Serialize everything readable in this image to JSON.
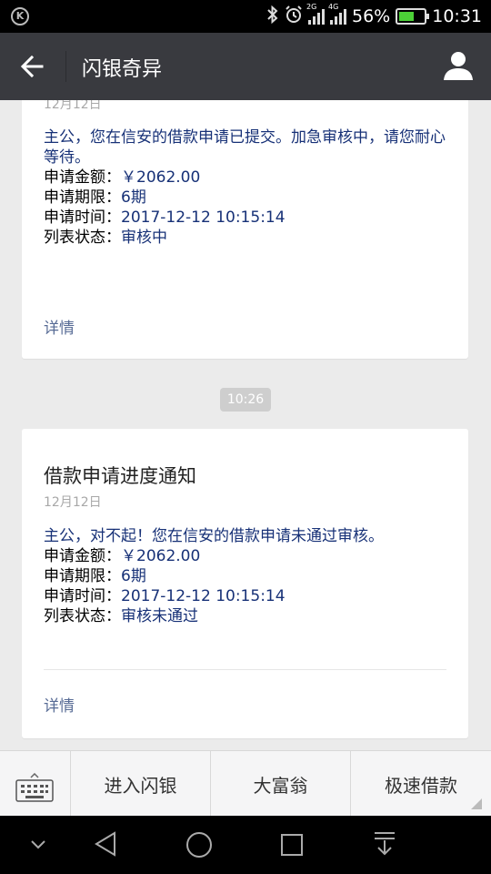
{
  "status_bar": {
    "left_icon": "k-circle-icon",
    "network_2g": "2G",
    "network_4g": "4G",
    "battery": "56%",
    "time": "10:31"
  },
  "header": {
    "title": "闪银奇异"
  },
  "messages": [
    {
      "date": "12月12日",
      "intro": "主公，您在信安的借款申请已提交。加急审核中，请您耐心等待。",
      "fields": [
        {
          "label": "申请金额：",
          "value": "￥2062.00"
        },
        {
          "label": "申请期限：",
          "value": "6期"
        },
        {
          "label": "申请时间：",
          "value": "2017-12-12 10:15:14"
        },
        {
          "label": "列表状态：",
          "value": "审核中"
        }
      ],
      "detail": "详情"
    },
    {
      "time_divider": "10:26",
      "title": "借款申请进度通知",
      "date": "12月12日",
      "intro": "主公，对不起！您在信安的借款申请未通过审核。",
      "fields": [
        {
          "label": "申请金额：",
          "value": "￥2062.00"
        },
        {
          "label": "申请期限：",
          "value": "6期"
        },
        {
          "label": "申请时间：",
          "value": "2017-12-12 10:15:14"
        },
        {
          "label": "列表状态：",
          "value": "审核未通过"
        }
      ],
      "detail": "详情"
    }
  ],
  "bottom_menu": {
    "items": [
      "进入闪银",
      "大富翁",
      "极速借款"
    ]
  },
  "colors": {
    "title_bar": "#393a3f",
    "message_blue": "#173177",
    "link": "#576b95"
  }
}
